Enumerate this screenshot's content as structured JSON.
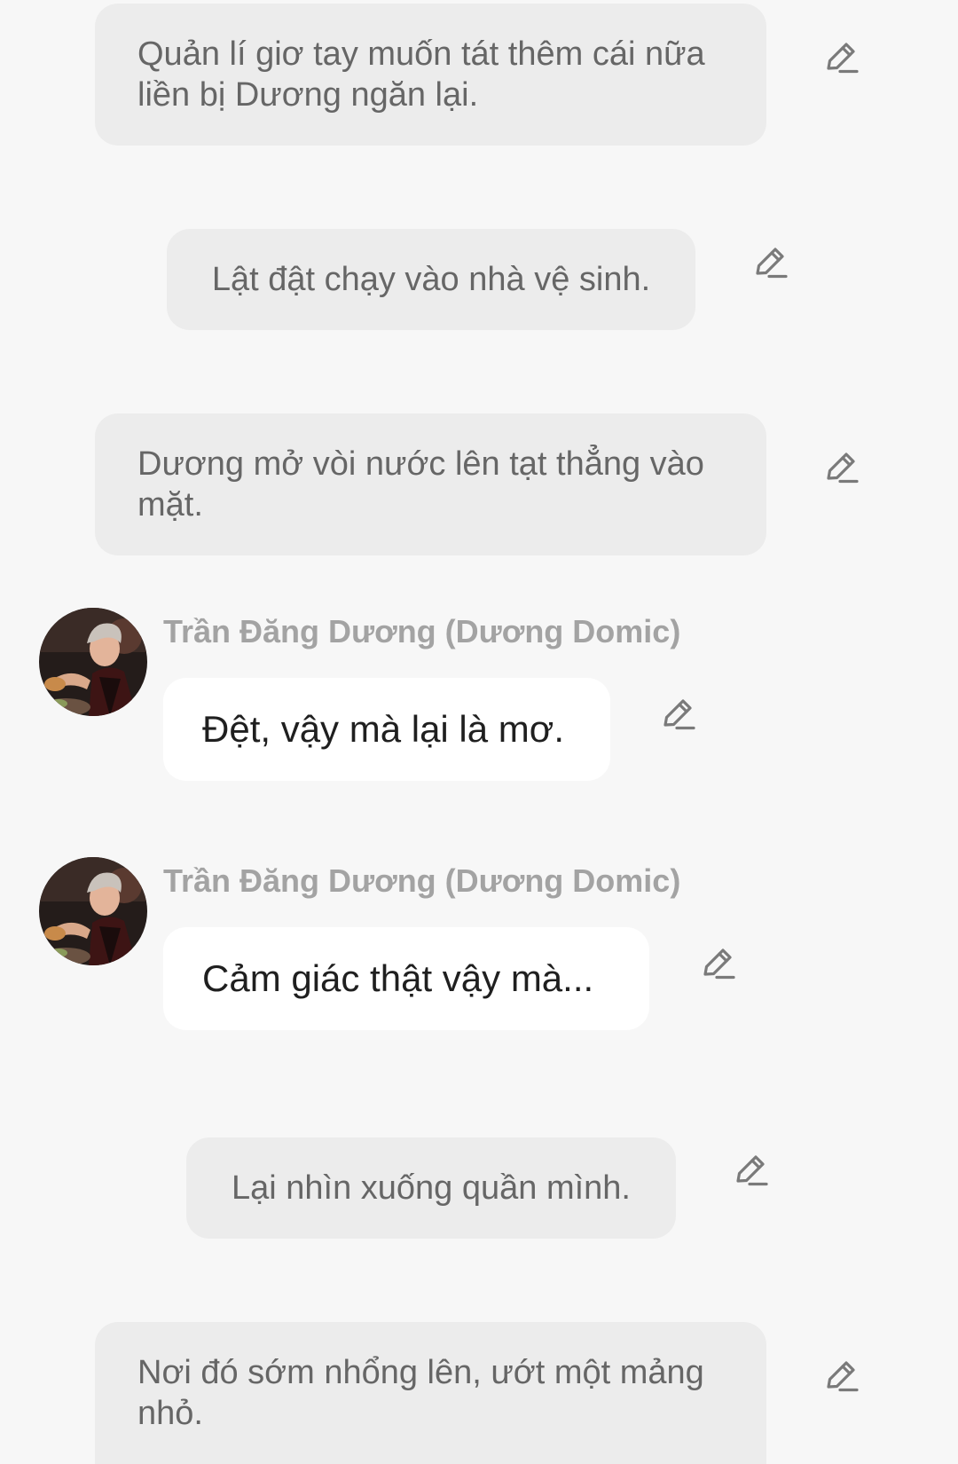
{
  "messages": [
    {
      "kind": "narration",
      "text": "Quản lí giơ tay muốn tát thêm cái nữa liền bị Dương ngăn lại."
    },
    {
      "kind": "narration",
      "text": "Lật đật chạy vào nhà vệ sinh."
    },
    {
      "kind": "narration",
      "text": "Dương mở vòi nước lên tạt thẳng vào mặt."
    },
    {
      "kind": "dialogue",
      "speaker": "Trần Đăng Dương (Dương Domic)",
      "text": "Đệt, vậy mà lại là mơ."
    },
    {
      "kind": "dialogue",
      "speaker": "Trần Đăng Dương (Dương Domic)",
      "text": "Cảm giác thật vậy mà..."
    },
    {
      "kind": "narration",
      "text": "Lại nhìn xuống quần mình."
    },
    {
      "kind": "narration",
      "text": "Nơi đó sớm nhổng lên, ướt một mảng nhỏ."
    }
  ],
  "icons": {
    "edit": "pencil-edit-icon",
    "avatar": "profile-photo"
  },
  "colors": {
    "background": "#f7f7f7",
    "narration_bubble": "#ececec",
    "dialogue_bubble": "#ffffff",
    "speaker_name": "#a3a3a3",
    "icon": "#7a7a7a"
  }
}
